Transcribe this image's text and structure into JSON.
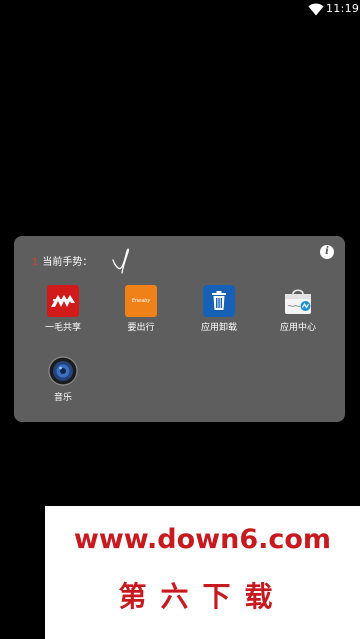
{
  "status_bar": {
    "time": "11:19",
    "wifi_icon": "wifi-icon"
  },
  "gesture_panel": {
    "index": "1",
    "label": "当前手势：",
    "gesture_icon": "handwritten-gesture-icon",
    "info_icon": "info-icon",
    "info_glyph": "i",
    "apps": [
      {
        "label": "一毛共享",
        "icon": "yimao-share-icon"
      },
      {
        "label": "要出行",
        "icon": "yaochuxing-icon",
        "icon_text": "Eneaby"
      },
      {
        "label": "应用卸载",
        "icon": "trash-icon"
      },
      {
        "label": "应用中心",
        "icon": "app-center-icon"
      },
      {
        "label": "音乐",
        "icon": "speaker-icon"
      }
    ]
  },
  "watermark": {
    "url": "www.down6.com",
    "name": "第六下载"
  },
  "colors": {
    "background": "#000000",
    "panel": "#5e5e5e",
    "accent_red": "#c8191f",
    "index_red": "#e23a2a"
  }
}
